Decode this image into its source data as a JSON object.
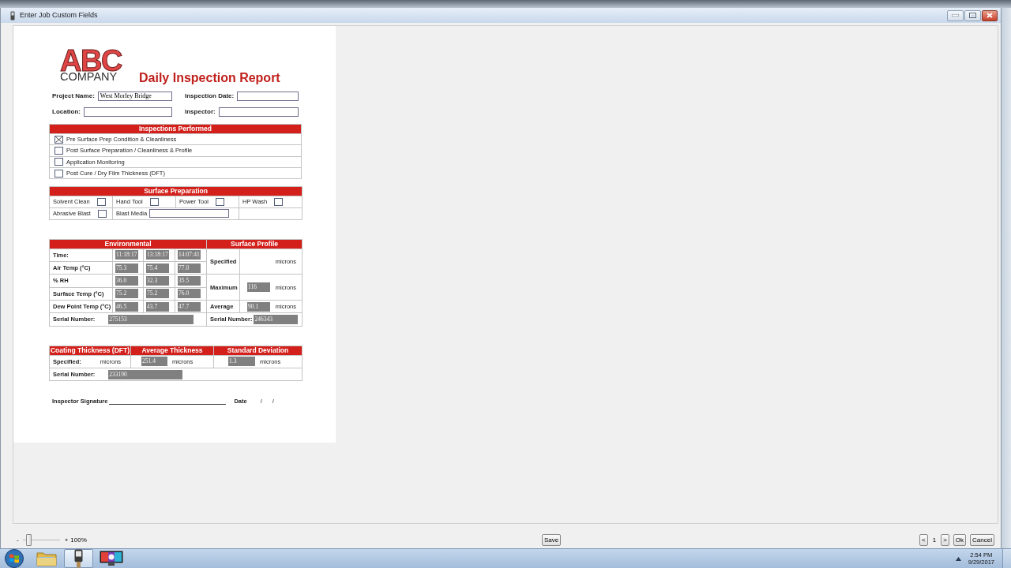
{
  "window": {
    "title": "Enter Job Custom Fields"
  },
  "report": {
    "logo": {
      "letters": "ABC",
      "company": "COMPANY"
    },
    "title": "Daily Inspection Report",
    "fields": [
      {
        "label": "Project Name:",
        "value": "West Morley Bridge"
      },
      {
        "label": "Inspection Date:"
      },
      {
        "label": "Location:"
      },
      {
        "label": "Inspector:"
      }
    ],
    "inspections": {
      "heading": "Inspections Performed",
      "items": [
        {
          "label": "Pre Surface Prep Condition & Cleanliness",
          "checked": true
        },
        {
          "label": "Post Surface Preparation / Cleanliness & Profile",
          "checked": false
        },
        {
          "label": "Application Monitoring",
          "checked": false
        },
        {
          "label": "Post Cure / Dry Film Thickness (DFT)",
          "checked": false
        }
      ]
    },
    "surface_preparation": {
      "heading": "Surface Preparation",
      "items": [
        {
          "kind": "checkbox",
          "label": "Solvent Clean",
          "checked": false
        },
        {
          "kind": "checkbox",
          "label": "Hand Tool",
          "checked": false
        },
        {
          "kind": "checkbox",
          "label": "Power Tool",
          "checked": false
        },
        {
          "kind": "checkbox",
          "label": "HP Wash",
          "checked": false
        },
        {
          "kind": "checkbox",
          "label": "Abrasive Blast",
          "checked": false
        },
        {
          "kind": "field",
          "label": "Blast Media"
        }
      ]
    },
    "environmental": {
      "heading": "Environmental",
      "rows": [
        {
          "label": "Time:",
          "values": [
            "11:18:17",
            "13:18:17",
            "14:07:41"
          ]
        },
        {
          "label": "Air Temp (°C)",
          "values": [
            "75.3",
            "75.4",
            "77.0"
          ]
        },
        {
          "label": "% RH",
          "values": [
            "36.0",
            "32.3",
            "35.5"
          ]
        },
        {
          "label": "Surface Temp  (°C)",
          "values": [
            "75.2",
            "75.2",
            "76.0"
          ]
        },
        {
          "label": "Dew Point Temp (°C)",
          "values": [
            "46.5",
            "43.7",
            "47.7"
          ]
        }
      ],
      "serial": {
        "label": "Serial Number:",
        "value": "275153"
      }
    },
    "surface_profile": {
      "heading": "Surface Profile",
      "rows": [
        {
          "label": "Specified",
          "unit": "microns"
        },
        {
          "label": "Maximum",
          "value": "116",
          "unit": "microns"
        },
        {
          "label": "Average",
          "value": "90.1",
          "unit": "microns"
        }
      ],
      "serial": {
        "label": "Serial Number:",
        "value": "246343"
      }
    },
    "coating": {
      "headings": [
        "Coating Thickness (DFT)",
        "Average Thickness",
        "Standard Deviation"
      ],
      "cells": [
        {
          "label": "Specified:",
          "unit": "microns"
        },
        {
          "value": "251.4",
          "unit": "microns"
        },
        {
          "value": "1.3",
          "unit": "microns"
        }
      ],
      "serial": {
        "label": "Serial Number:",
        "value": "233190"
      }
    },
    "signature": {
      "label": "Inspector Signature",
      "date_label": "Date",
      "date_marks": [
        "/",
        "/"
      ]
    }
  },
  "zoom": {
    "minus": "-",
    "plus": "+",
    "percent": "100%",
    "level": 0.12
  },
  "save_button": "Save",
  "pager": {
    "prev": "<",
    "page": "1",
    "next": ">"
  },
  "buttons": [
    "Ok",
    "Cancel"
  ],
  "taskbar": {
    "apps": [
      {
        "kind": "folder",
        "selected": false
      },
      {
        "kind": "device",
        "selected": true
      },
      {
        "kind": "display",
        "selected": false
      }
    ],
    "time": "2:54 PM",
    "date": "9/29/2017"
  }
}
